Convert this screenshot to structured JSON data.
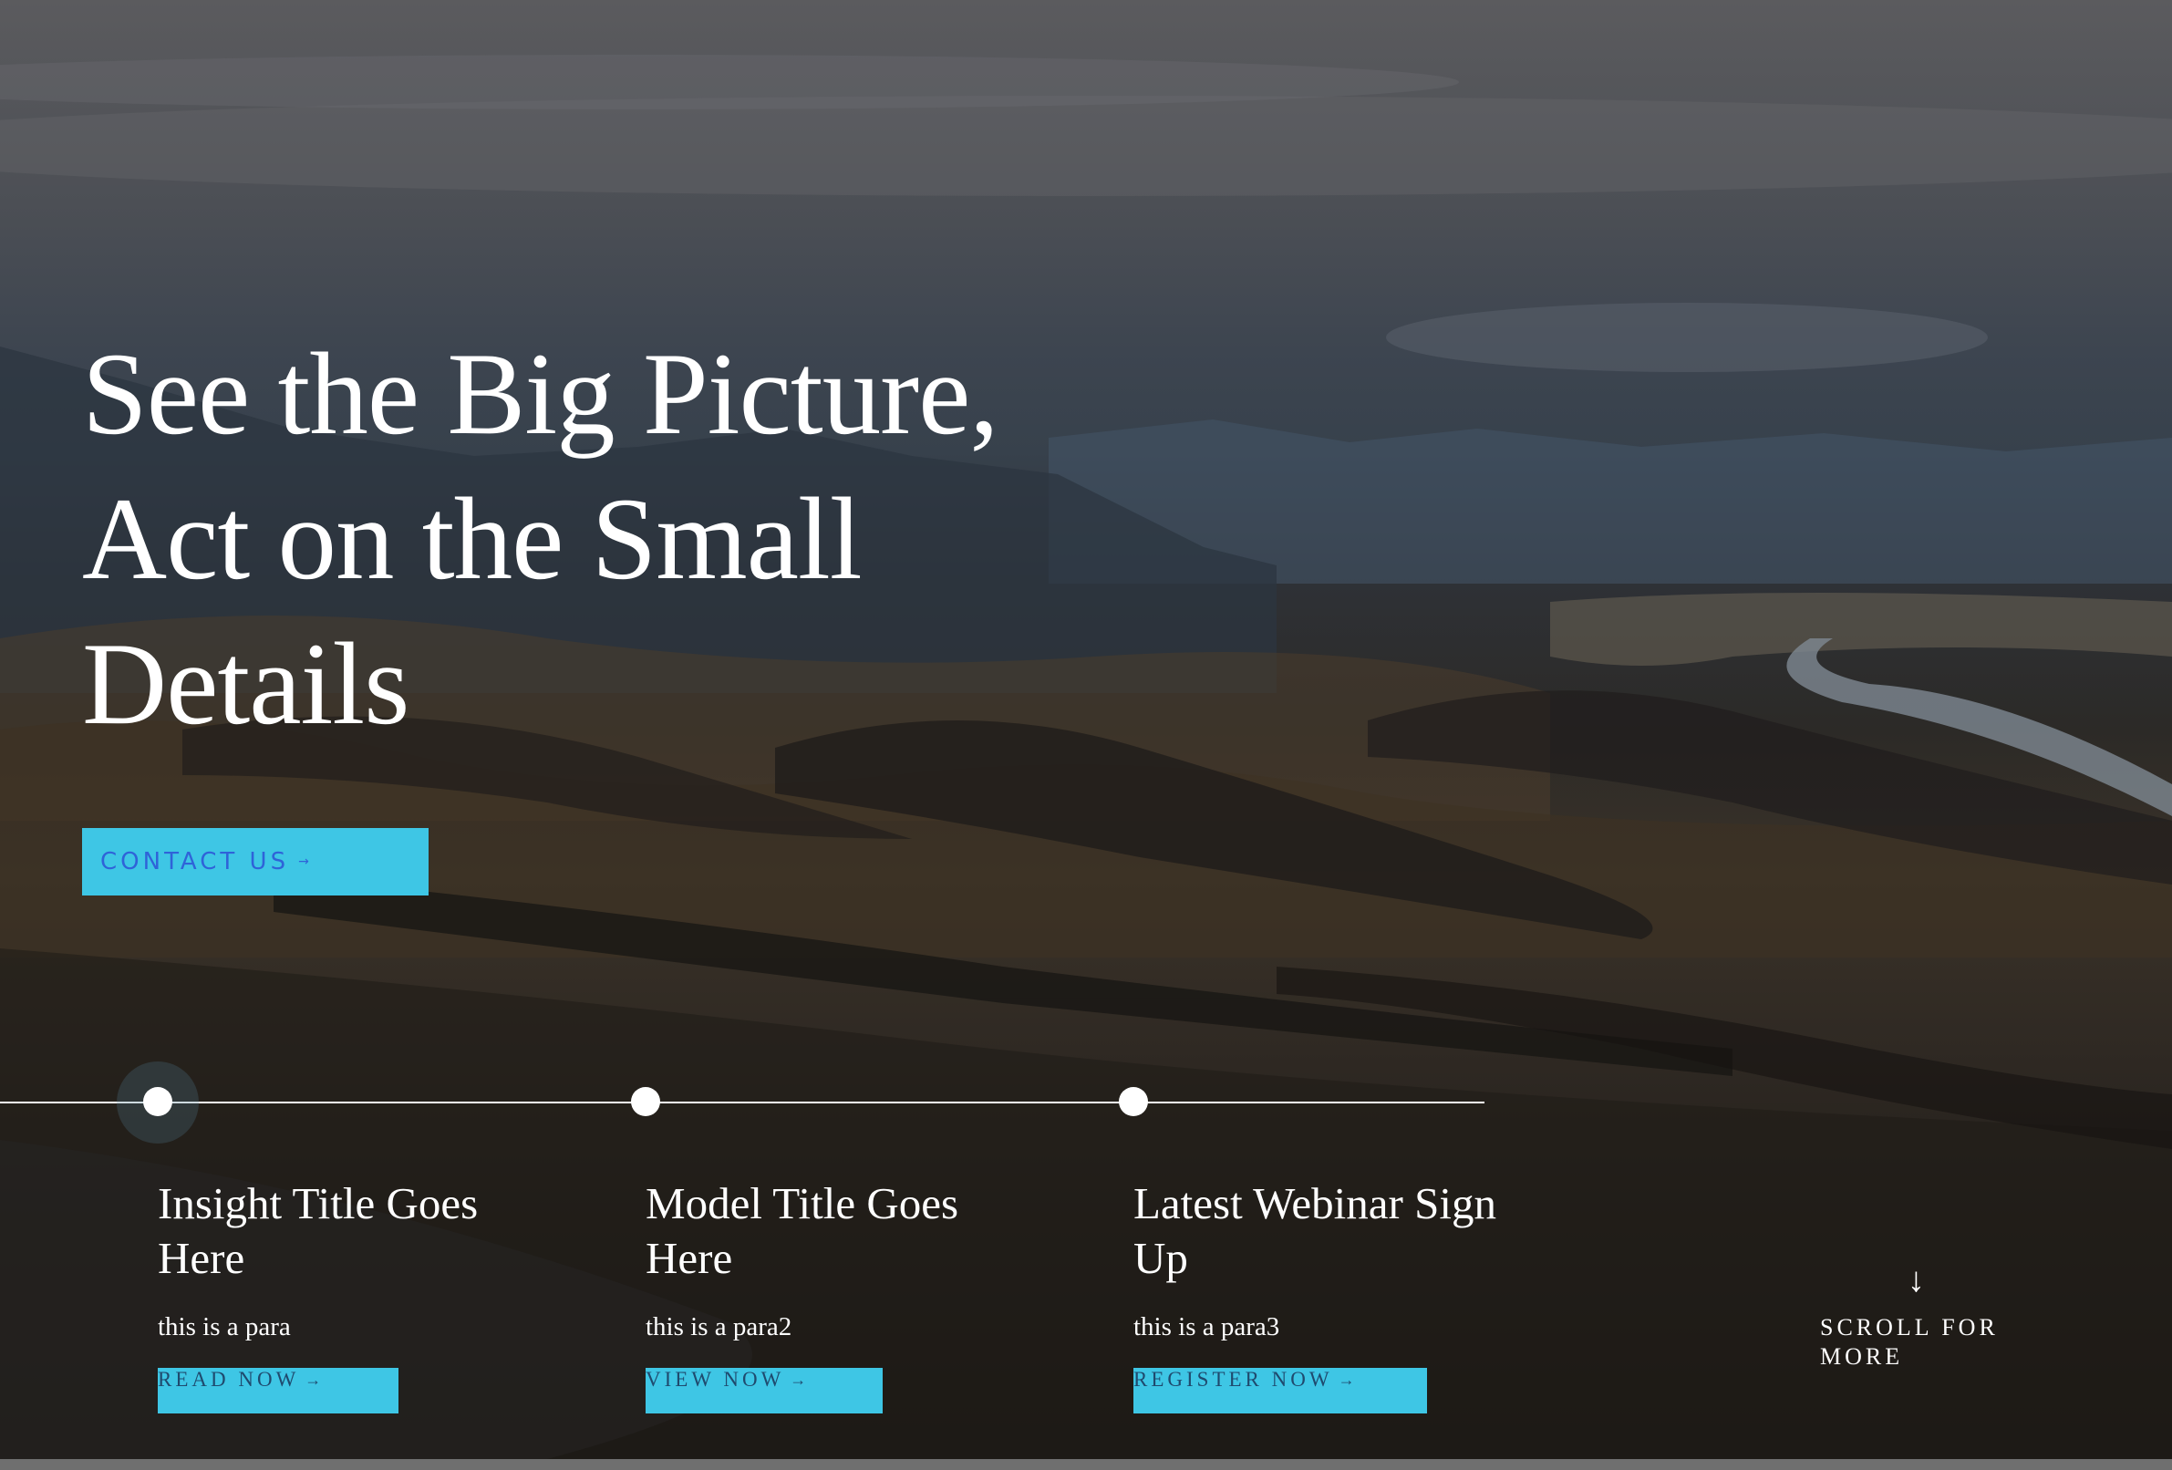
{
  "hero": {
    "headline": "See the Big Picture, Act on the Small Details",
    "cta": {
      "label": "CONTACT US",
      "arrow": "→"
    }
  },
  "timeline": {
    "items": [
      {
        "title": "Insight Title Goes Here",
        "text": "this is a para",
        "button": "READ NOW",
        "arrow": "→"
      },
      {
        "title": "Model Title Goes Here",
        "text": "this is a para2",
        "button": "VIEW NOW",
        "arrow": "→"
      },
      {
        "title": "Latest Webinar Sign Up",
        "text": "this is a para3",
        "button": "REGISTER NOW",
        "arrow": "→"
      }
    ]
  },
  "scroll": {
    "arrow": "↓",
    "label": "SCROLL FOR MORE"
  },
  "colors": {
    "accent": "#3ec6e5",
    "cta_text": "#2f63d8",
    "card_button_text": "#1f4a6e",
    "text": "#ffffff"
  }
}
